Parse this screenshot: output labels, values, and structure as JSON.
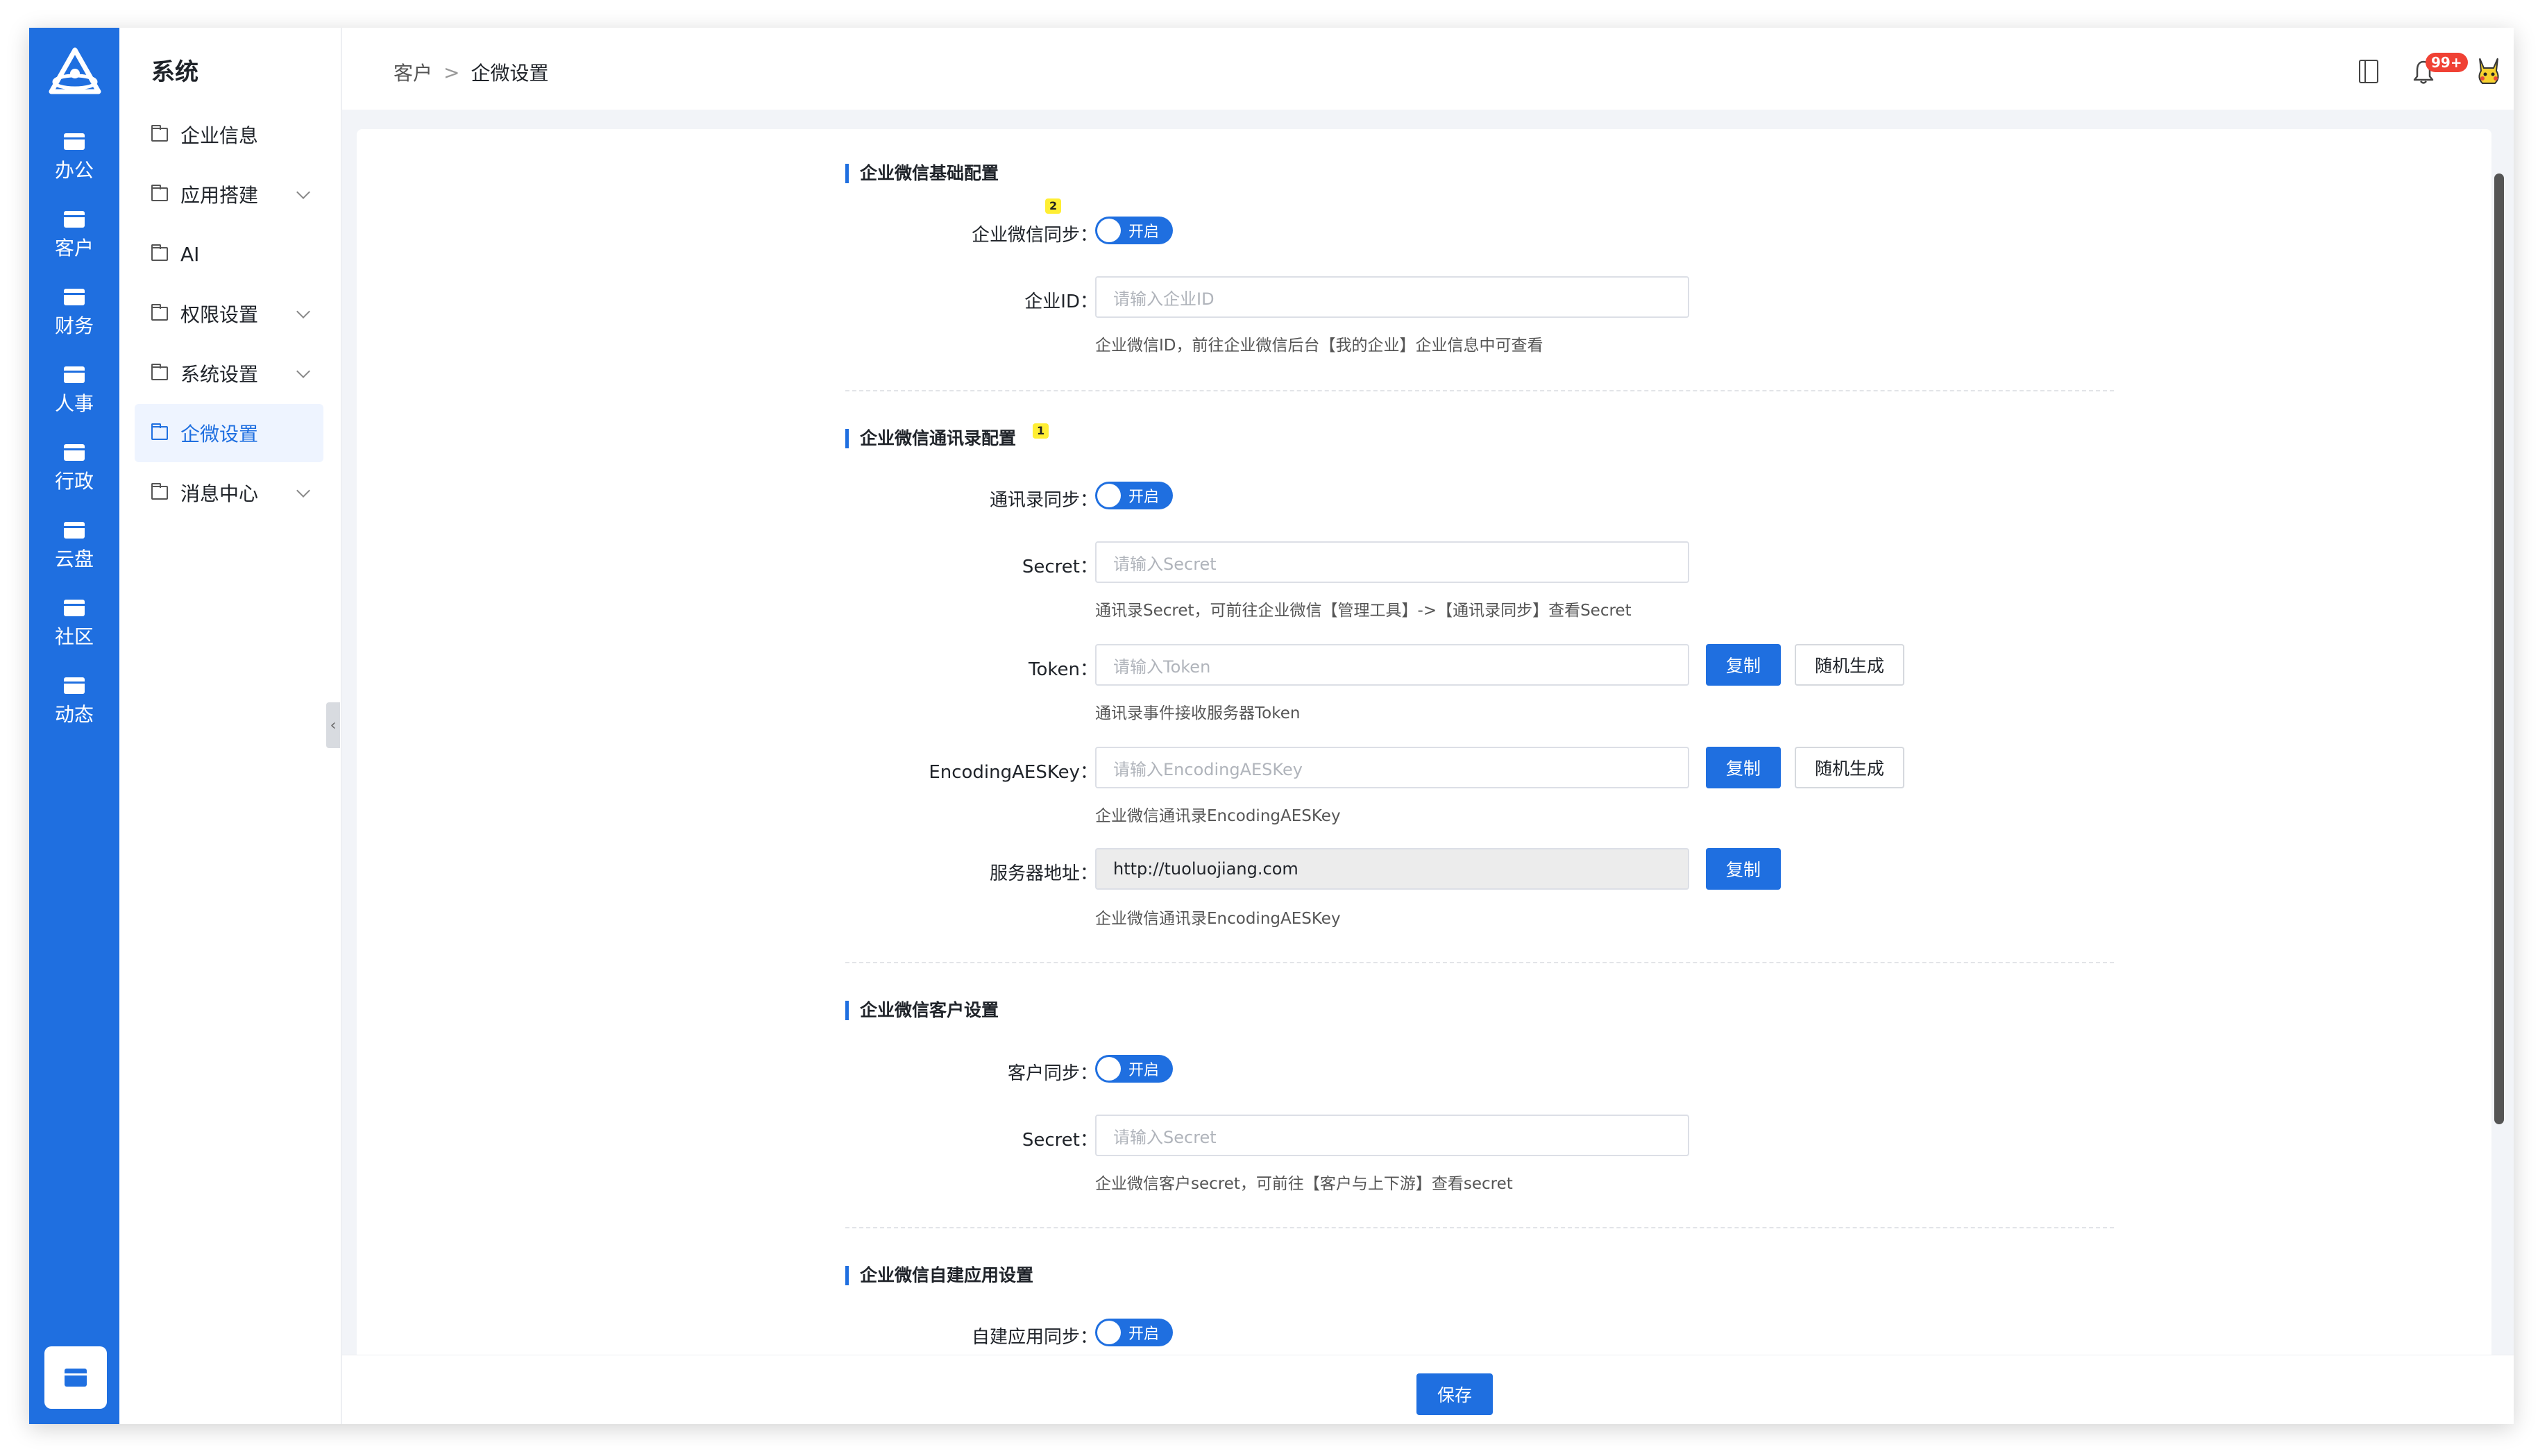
{
  "rail": {
    "items": [
      "办公",
      "客户",
      "财务",
      "人事",
      "行政",
      "云盘",
      "社区",
      "动态"
    ]
  },
  "sidebar": {
    "title": "系统",
    "items": [
      {
        "label": "企业信息"
      },
      {
        "label": "应用搭建"
      },
      {
        "label": "AI"
      },
      {
        "label": "权限设置"
      },
      {
        "label": "系统设置"
      },
      {
        "label": "企微设置"
      },
      {
        "label": "消息中心"
      }
    ]
  },
  "header": {
    "breadcrumb": [
      "客户",
      "企微设置"
    ],
    "breadcrumb_sep": ">",
    "notification_badge": "99+"
  },
  "sections": {
    "basic": {
      "title": "企业微信基础配置",
      "sync_label": "企业微信同步：",
      "sync_state": "开启",
      "corp_id_label": "企业ID：",
      "corp_id_placeholder": "请输入企业ID",
      "corp_id_hint": "企业微信ID，前往企业微信后台【我的企业】企业信息中可查看"
    },
    "contacts": {
      "title": "企业微信通讯录配置",
      "sync_label": "通讯录同步：",
      "sync_state": "开启",
      "secret_label": "Secret：",
      "secret_placeholder": "请输入Secret",
      "secret_hint": "通讯录Secret，可前往企业微信【管理工具】->【通讯录同步】查看Secret",
      "token_label": "Token：",
      "token_placeholder": "请输入Token",
      "token_hint": "通讯录事件接收服务器Token",
      "aes_label": "EncodingAESKey：",
      "aes_placeholder": "请输入EncodingAESKey",
      "aes_hint": "企业微信通讯录EncodingAESKey",
      "server_label": "服务器地址：",
      "server_value": "http://tuoluojiang.com",
      "server_hint": "企业微信通讯录EncodingAESKey",
      "copy_label": "复制",
      "random_label": "随机生成"
    },
    "customer": {
      "title": "企业微信客户设置",
      "sync_label": "客户同步：",
      "sync_state": "开启",
      "secret_label": "Secret：",
      "secret_placeholder": "请输入Secret",
      "secret_hint": "企业微信客户secret，可前往【客户与上下游】查看secret"
    },
    "app": {
      "title": "企业微信自建应用设置",
      "sync_label": "自建应用同步：",
      "sync_state": "开启"
    }
  },
  "markers": {
    "one": "1",
    "two": "2"
  },
  "footer": {
    "save_label": "保存"
  },
  "colors": {
    "primary": "#1f6fe0",
    "badge": "#f04134"
  }
}
